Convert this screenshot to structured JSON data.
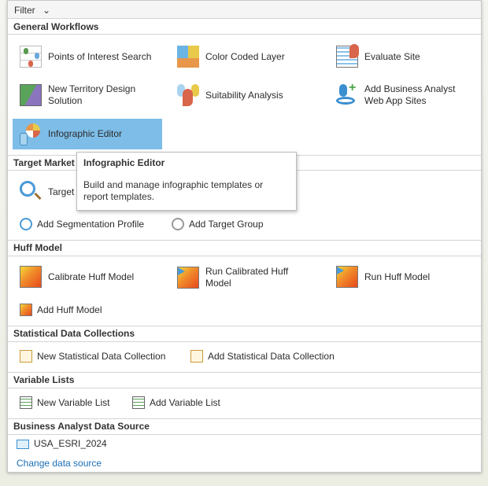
{
  "filter": {
    "label": "Filter"
  },
  "general": {
    "title": "General Workflows",
    "items": [
      {
        "label": "Points of Interest Search"
      },
      {
        "label": "Color Coded Layer"
      },
      {
        "label": "Evaluate Site"
      },
      {
        "label": "New Territory Design Solution"
      },
      {
        "label": "Suitability Analysis"
      },
      {
        "label": "Add Business Analyst Web App Sites"
      },
      {
        "label": "Infographic Editor"
      }
    ]
  },
  "target": {
    "title": "Target Market",
    "items": [
      {
        "label": "Target M"
      },
      {
        "label": "Add Segmentation Profile"
      },
      {
        "label": "Add Target Group"
      }
    ]
  },
  "tooltip": {
    "title": "Infographic Editor",
    "body": "Build and manage infographic templates or report templates."
  },
  "huff": {
    "title": "Huff Model",
    "items": [
      {
        "label": "Calibrate Huff Model"
      },
      {
        "label": "Run Calibrated Huff Model"
      },
      {
        "label": "Run Huff Model"
      },
      {
        "label": "Add Huff Model"
      }
    ]
  },
  "stat": {
    "title": "Statistical Data Collections",
    "items": [
      {
        "label": "New Statistical Data Collection"
      },
      {
        "label": "Add Statistical Data Collection"
      }
    ]
  },
  "vars": {
    "title": "Variable Lists",
    "items": [
      {
        "label": "New Variable List"
      },
      {
        "label": "Add Variable List"
      }
    ]
  },
  "source": {
    "title": "Business Analyst Data Source",
    "current": "USA_ESRI_2024",
    "change": "Change data source"
  }
}
